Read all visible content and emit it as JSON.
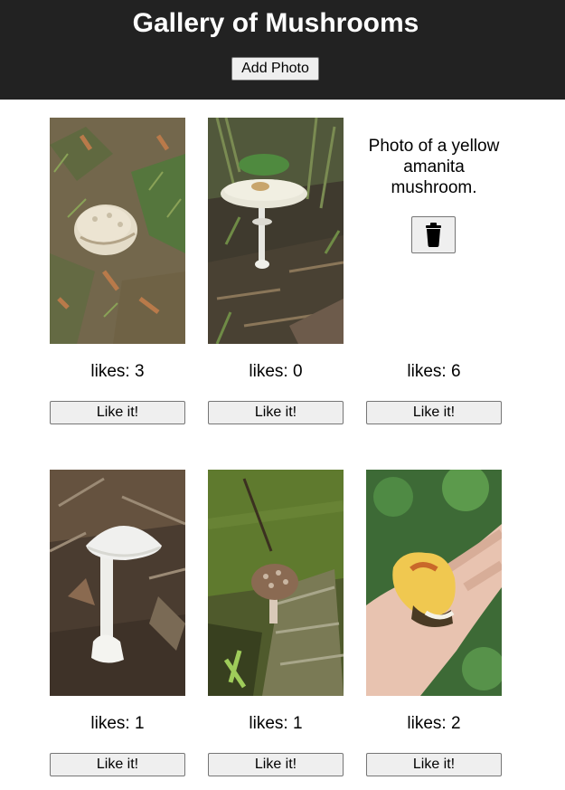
{
  "header": {
    "title": "Gallery of Mushrooms",
    "add_photo_label": "Add Photo",
    "background": "#222222"
  },
  "gallery": {
    "cards": [
      {
        "type": "photo",
        "subject": "white mushroom cap in grass",
        "likes_text": "likes: 3",
        "like_label": "Like it!"
      },
      {
        "type": "photo",
        "subject": "pale mushroom on tall stem in forest litter",
        "likes_text": "likes: 0",
        "like_label": "Like it!"
      },
      {
        "type": "caption",
        "caption": "Photo of a yellow amanita mushroom.",
        "delete_icon": "trash-icon",
        "likes_text": "likes: 6",
        "like_label": "Like it!"
      },
      {
        "type": "photo",
        "subject": "white amanita mushroom on dirt",
        "likes_text": "likes: 1",
        "like_label": "Like it!"
      },
      {
        "type": "photo",
        "subject": "brown scaly mushroom on mossy log",
        "likes_text": "likes: 1",
        "like_label": "Like it!"
      },
      {
        "type": "photo",
        "subject": "yellow mushroom held in a hand",
        "likes_text": "likes: 2",
        "like_label": "Like it!"
      }
    ]
  }
}
